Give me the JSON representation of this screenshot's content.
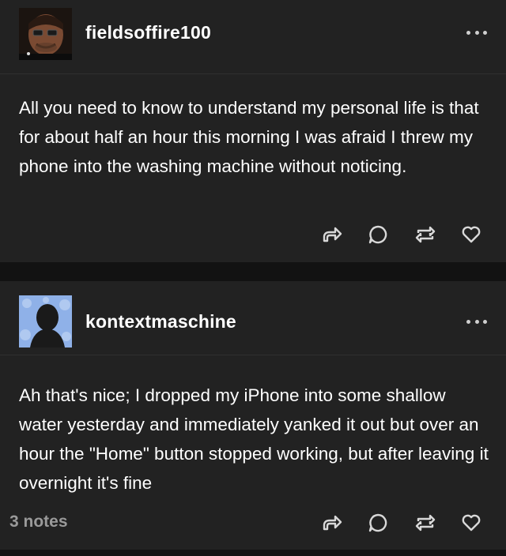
{
  "posts": [
    {
      "username": "fieldsoffire100",
      "text": "All you need to know to understand my personal life is that for about half an hour this morning I was afraid I threw my phone into the washing machine without noticing.",
      "avatar_icon": "user-avatar-photo"
    },
    {
      "username": "kontextmaschine",
      "text": "Ah that's nice; I dropped my iPhone into some shallow water yesterday and immediately yanked it out but over an hour the \"Home\" button stopped working, but after leaving it overnight it's fine",
      "notes": "3 notes",
      "avatar_icon": "default-silhouette-avatar"
    }
  ],
  "icons": {
    "share": "share-arrow-icon",
    "reply": "reply-bubble-icon",
    "reblog": "reblog-icon",
    "like": "heart-icon",
    "more": "more-dots-icon"
  },
  "colors": {
    "background": "#121212",
    "card": "#222222",
    "text": "#ffffff",
    "muted": "#9a9a9a",
    "avatar2_bg": "#8fb1e8"
  }
}
